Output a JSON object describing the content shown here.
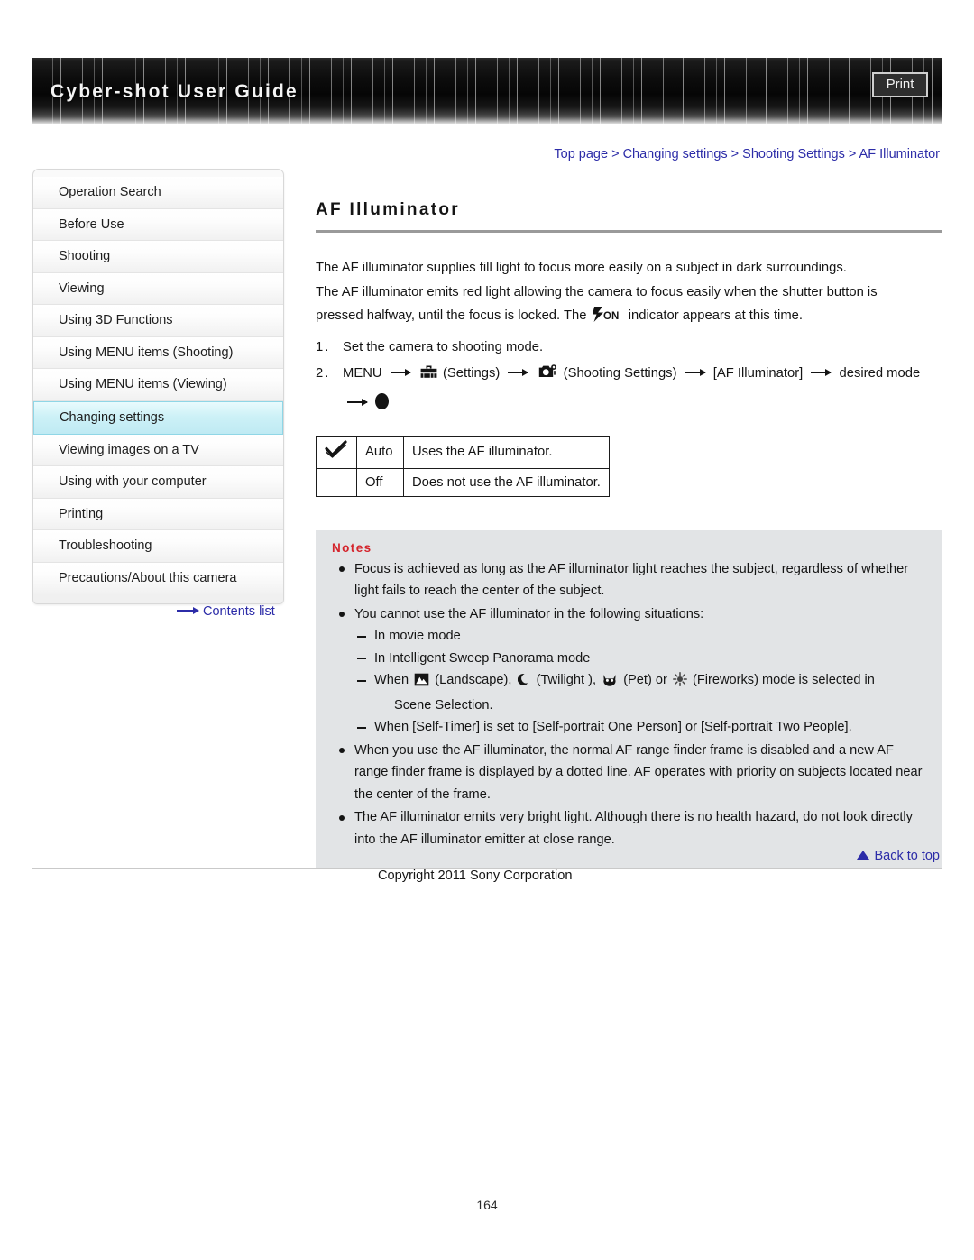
{
  "header": {
    "title": "Cyber-shot User Guide",
    "print_label": "Print"
  },
  "breadcrumb": {
    "text": "Top page > Changing settings > Shooting Settings > AF Illuminator",
    "items": [
      "Top page",
      "Changing settings",
      "Shooting Settings",
      "AF Illuminator"
    ],
    "separator": ">",
    "color": "#2c2ca8"
  },
  "sidebar": {
    "items": [
      {
        "label": "Operation Search",
        "active": false
      },
      {
        "label": "Before Use",
        "active": false
      },
      {
        "label": "Shooting",
        "active": false
      },
      {
        "label": "Viewing",
        "active": false
      },
      {
        "label": "Using 3D Functions",
        "active": false
      },
      {
        "label": "Using MENU items (Shooting)",
        "active": false
      },
      {
        "label": "Using MENU items (Viewing)",
        "active": false
      },
      {
        "label": "Changing settings",
        "active": true
      },
      {
        "label": "Viewing images on a TV",
        "active": false
      },
      {
        "label": "Using with your computer",
        "active": false
      },
      {
        "label": "Printing",
        "active": false
      },
      {
        "label": "Troubleshooting",
        "active": false
      },
      {
        "label": "Precautions/About this camera",
        "active": false
      }
    ],
    "contents_list_label": "Contents list",
    "active_color": "#bfeaf3"
  },
  "main": {
    "title": "AF Illuminator",
    "intro_line_1": "The AF illuminator supplies fill light to focus more easily on a subject in dark surroundings.",
    "intro_line_2": "The AF illuminator emits red light allowing the camera to focus easily when the shutter button is",
    "intro_line_3a": "pressed halfway, until the focus is locked. The",
    "intro_line_3b": "indicator appears at this time.",
    "steps": [
      {
        "num": "1.",
        "text": "Set the camera to shooting mode."
      }
    ],
    "step2": {
      "num": "2.",
      "menu_label": "MENU",
      "settings_label": "(Settings)",
      "shooting_settings_label": "(Shooting Settings)",
      "item_label": "[AF Illuminator]",
      "desired_mode_label": "desired mode"
    },
    "options_table": {
      "rows": [
        {
          "checked": true,
          "name": "Auto",
          "description": "Uses the AF illuminator."
        },
        {
          "checked": false,
          "name": "Off",
          "description": "Does not use the AF illuminator."
        }
      ]
    },
    "notes": {
      "title": "Notes",
      "items": [
        {
          "lines": [
            "Focus is achieved as long as the AF illuminator light reaches the subject, regardless of",
            "whether light fails to reach the center of the subject."
          ],
          "sub": []
        },
        {
          "lines": [
            "You cannot use the AF illuminator in the following situations:"
          ],
          "sub": [
            {
              "text": "In movie mode"
            },
            {
              "text": "In Intelligent Sweep Panorama mode"
            },
            {
              "prefix": "When",
              "landscape_label": "(Landscape),",
              "twilight_label": "(Twilight ),",
              "pet_label": "(Pet) or",
              "fireworks_label": "(Fireworks) mode is selected in",
              "continuation": "Scene Selection."
            },
            {
              "text": "When [Self-Timer] is set to [Self-portrait One Person] or [Self-portrait Two People]."
            }
          ]
        },
        {
          "lines": [
            "When you use the AF illuminator, the normal AF range finder frame is disabled and a new",
            "AF range finder frame is displayed by a dotted line. AF operates with priority on subjects",
            "located near the center of the frame."
          ],
          "sub": []
        },
        {
          "lines": [
            "The AF illuminator emits very bright light. Although there is no health hazard, do not look",
            "directly into the AF illuminator emitter at close range."
          ],
          "sub": []
        }
      ]
    }
  },
  "footer": {
    "back_to_top_label": "Back to top",
    "copyright": "Copyright 2011 Sony Corporation",
    "page_number": "164"
  }
}
